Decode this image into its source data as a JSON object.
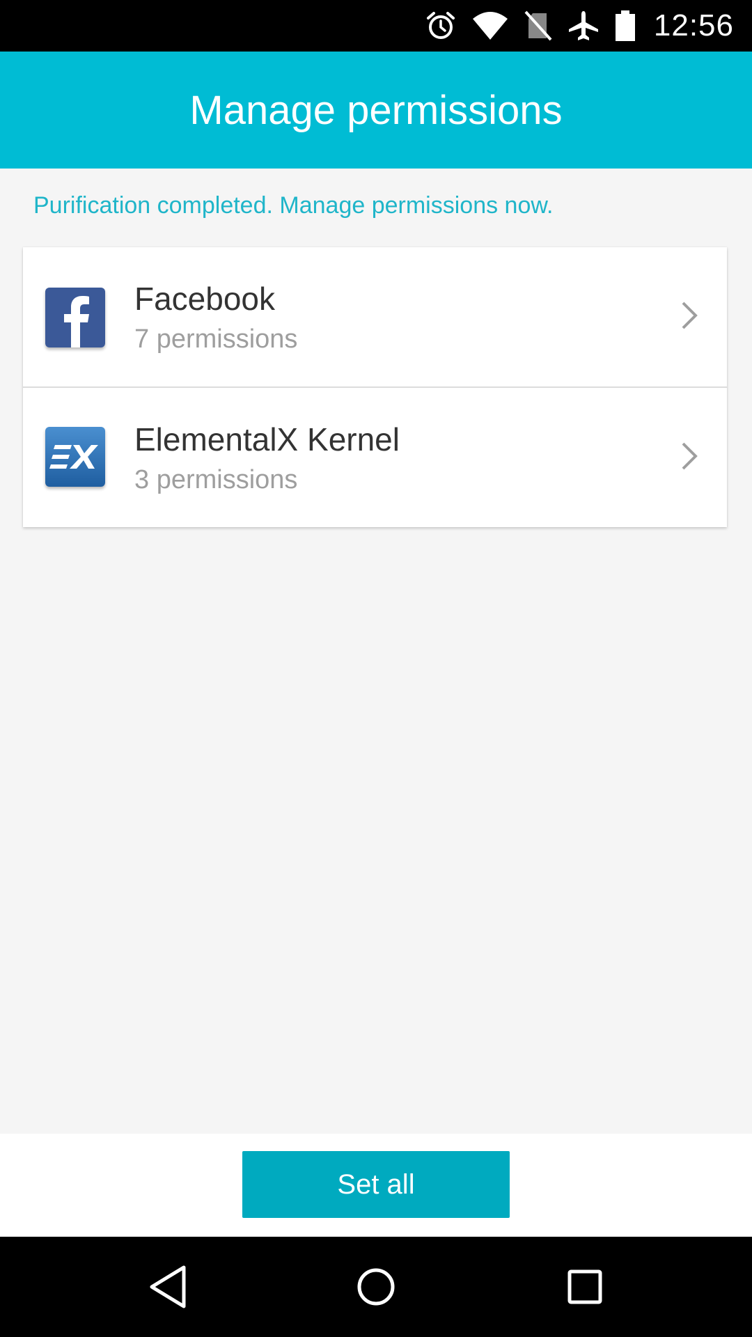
{
  "status_bar": {
    "time": "12:56",
    "icons": [
      "alarm-icon",
      "wifi-icon",
      "no-sim-icon",
      "airplane-mode-icon",
      "battery-icon"
    ]
  },
  "app_bar": {
    "title": "Manage permissions",
    "color": "#00bcd4"
  },
  "notice": {
    "text": "Purification completed. Manage permissions now.",
    "color": "#1fb5c9"
  },
  "apps": [
    {
      "name": "Facebook",
      "permissions": "7 permissions",
      "icon": "facebook-icon"
    },
    {
      "name": "ElementalX Kernel",
      "permissions": "3 permissions",
      "icon": "elementalx-icon"
    }
  ],
  "actions": {
    "set_all_label": "Set all",
    "button_color": "#00aabf"
  },
  "nav_bar": {
    "buttons": [
      "back-icon",
      "home-icon",
      "recents-icon"
    ]
  }
}
